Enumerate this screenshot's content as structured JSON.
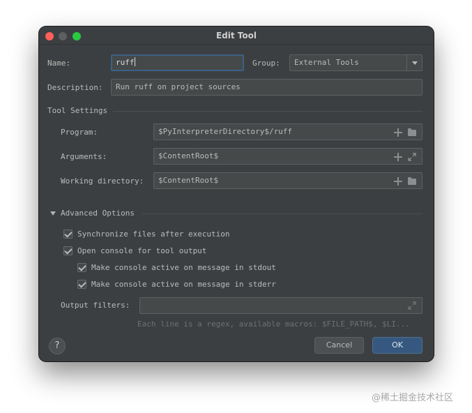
{
  "window": {
    "title": "Edit Tool"
  },
  "general": {
    "name_label": "Name:",
    "name_value": "ruff",
    "group_label": "Group:",
    "group_value": "External Tools",
    "description_label": "Description:",
    "description_value": "Run ruff on project sources"
  },
  "tool_settings": {
    "header": "Tool Settings",
    "program_label": "Program:",
    "program_value": "$PyInterpreterDirectory$/ruff",
    "arguments_label": "Arguments:",
    "arguments_value": "$ContentRoot$",
    "working_dir_label": "Working directory:",
    "working_dir_value": "$ContentRoot$"
  },
  "advanced": {
    "header": "Advanced Options",
    "sync_files": {
      "label": "Synchronize files after execution",
      "checked": true
    },
    "open_console": {
      "label": "Open console for tool output",
      "checked": true
    },
    "active_stdout": {
      "label": "Make console active on message in stdout",
      "checked": true
    },
    "active_stderr": {
      "label": "Make console active on message in stderr",
      "checked": true
    },
    "output_filters_label": "Output filters:",
    "output_filters_value": "",
    "output_filters_hint": "Each line is a regex, available macros: $FILE_PATH$, $LI..."
  },
  "footer": {
    "help_label": "?",
    "cancel_label": "Cancel",
    "ok_label": "OK"
  },
  "watermark": "@稀土掘金技术社区",
  "colors": {
    "window_bg": "#3c3f41",
    "field_bg": "#45494a",
    "accent": "#365880",
    "focus_border": "#3d6185"
  },
  "icons": [
    "plus-icon",
    "folder-icon",
    "expand-icon",
    "chevron-down-icon",
    "collapse-triangle-icon",
    "checkbox-check-icon",
    "help-icon"
  ]
}
